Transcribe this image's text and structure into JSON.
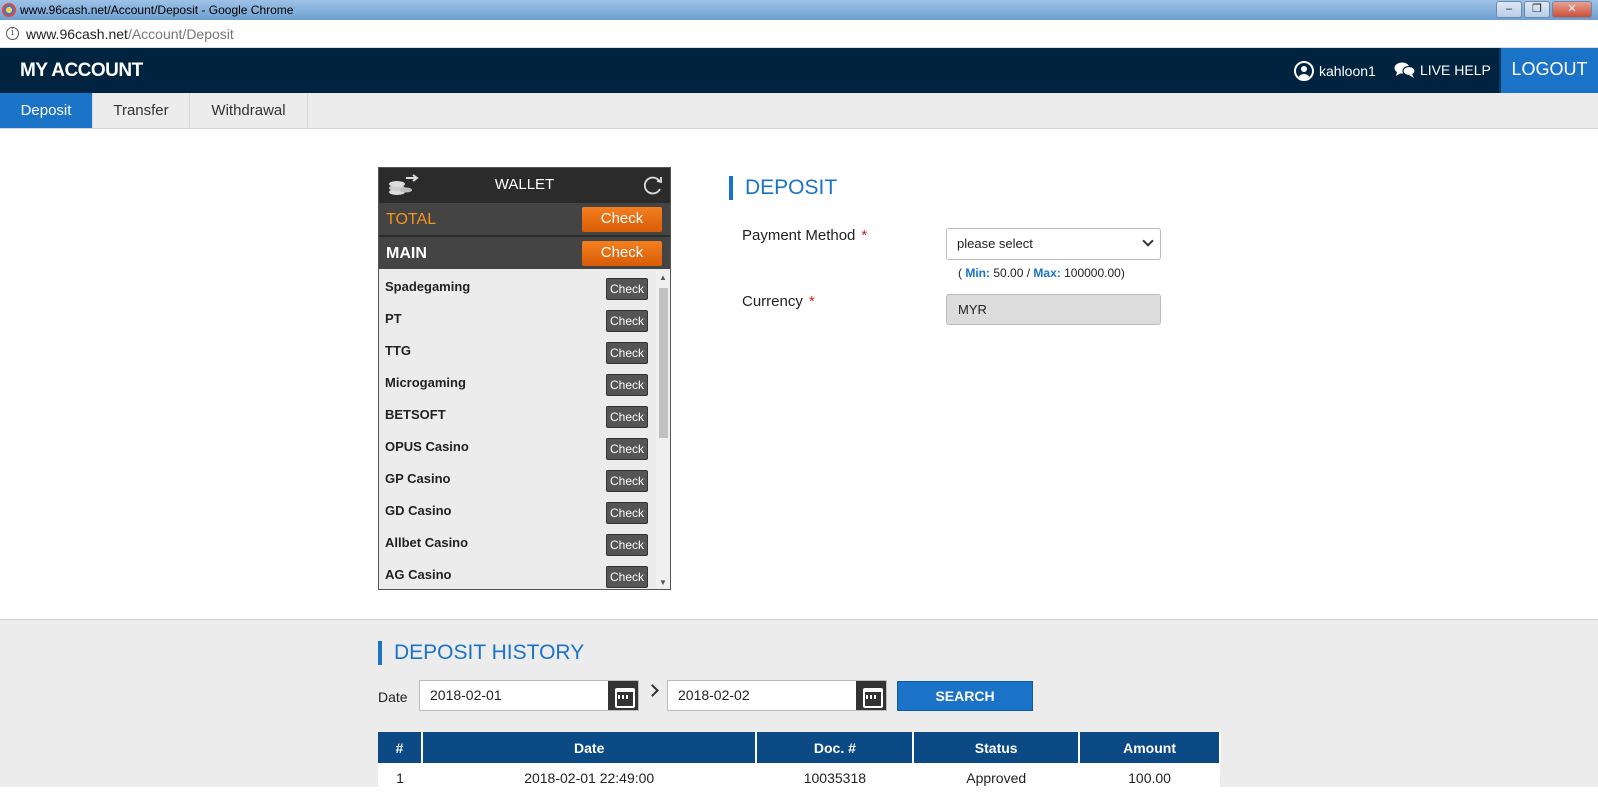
{
  "browser": {
    "window_title": "www.96cash.net/Account/Deposit - Google Chrome",
    "url_host": "www.96cash.net",
    "url_path": "/Account/Deposit"
  },
  "header": {
    "brand": "MY ACCOUNT",
    "username": "kahloon1",
    "live_help": "LIVE HELP",
    "logout": "LOGOUT"
  },
  "tabs": [
    {
      "label": "Deposit",
      "active": true
    },
    {
      "label": "Transfer",
      "active": false
    },
    {
      "label": "Withdrawal",
      "active": false
    }
  ],
  "wallet": {
    "title": "WALLET",
    "total_label": "TOTAL",
    "main_label": "MAIN",
    "check_label": "Check",
    "providers": [
      {
        "name": "Spadegaming",
        "check": "Check"
      },
      {
        "name": "PT",
        "check": "Check"
      },
      {
        "name": "TTG",
        "check": "Check"
      },
      {
        "name": "Microgaming",
        "check": "Check"
      },
      {
        "name": "BETSOFT",
        "check": "Check"
      },
      {
        "name": "OPUS Casino",
        "check": "Check"
      },
      {
        "name": "GP Casino",
        "check": "Check"
      },
      {
        "name": "GD Casino",
        "check": "Check"
      },
      {
        "name": "Allbet Casino",
        "check": "Check"
      },
      {
        "name": "AG Casino",
        "check": "Check"
      }
    ]
  },
  "deposit": {
    "title": "DEPOSIT",
    "payment_method_label": "Payment Method",
    "required_mark": "*",
    "payment_method_value": "please select",
    "limits_open": "(",
    "min_label": "Min:",
    "min_value": "50.00",
    "separator": "/",
    "max_label": "Max:",
    "max_value": "100000.00)",
    "currency_label": "Currency",
    "currency_value": "MYR"
  },
  "history": {
    "title": "DEPOSIT HISTORY",
    "date_label": "Date",
    "date_from": "2018-02-01",
    "date_to": "2018-02-02",
    "search_label": "SEARCH",
    "columns": [
      "#",
      "Date",
      "Doc. #",
      "Status",
      "Amount"
    ],
    "rows": [
      [
        "1",
        "2018-02-01 22:49:00",
        "10035318",
        "Approved",
        "100.00"
      ]
    ]
  },
  "colors": {
    "nav_bg": "#00233f",
    "accent_blue": "#1a73c7",
    "check_orange": "#f47f20",
    "table_header": "#0c4a86"
  }
}
